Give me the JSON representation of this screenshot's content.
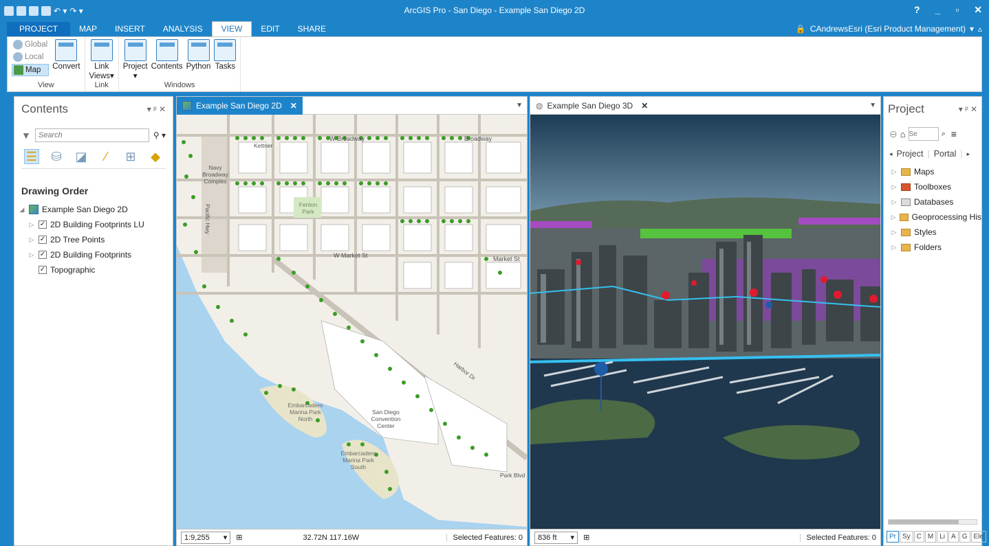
{
  "window": {
    "title": "ArcGIS Pro - San Diego - Example San Diego 2D",
    "help": "?",
    "minimize": "_",
    "restore": "▫",
    "close": "✕"
  },
  "ribbon_tabs": [
    "PROJECT",
    "MAP",
    "INSERT",
    "ANALYSIS",
    "VIEW",
    "EDIT",
    "SHARE"
  ],
  "active_tab": "VIEW",
  "user": {
    "name": "CAndrewsEsri (Esri Product Management)",
    "caret": "▾",
    "collapse": "▵"
  },
  "ribbon": {
    "view_group": {
      "label": "View",
      "global": "Global",
      "local": "Local",
      "map": "Map",
      "convert": "Convert"
    },
    "link_group": {
      "label": "Link",
      "link_views_line1": "Link",
      "link_views_line2": "Views",
      "caret": "▾"
    },
    "windows_group": {
      "label": "Windows",
      "project": "Project",
      "contents": "Contents",
      "python": "Python",
      "tasks": "Tasks"
    }
  },
  "contents": {
    "title": "Contents",
    "pin": "▾ ᵖ ✕",
    "search_placeholder": "Search",
    "section": "Drawing Order",
    "map_name": "Example San Diego 2D",
    "layers": [
      {
        "name": "2D Building Footprints LU",
        "checked": "✓"
      },
      {
        "name": "2D Tree Points",
        "checked": "✓"
      },
      {
        "name": "2D Building Footprints",
        "checked": "✓"
      },
      {
        "name": "Topographic",
        "checked": "✓"
      }
    ]
  },
  "map2d": {
    "tab": "Example San Diego 2D",
    "close": "✕",
    "scale": "1:9,255",
    "coords": "32.72N 117.16W",
    "selected": "Selected Features: 0",
    "labels": {
      "broadway": "W Broadway",
      "broadway_e": "Broadway",
      "market": "W Market St",
      "market_e": "Market St",
      "navy": "Navy Broadway Complex",
      "pacific": "Pacific Hwy",
      "convention": "San Diego Convention Center",
      "marina_north": "Embarcadero Marina Park North",
      "marina_south": "Embarcadero Marina Park South",
      "harbor": "Harbor Dr",
      "parkblvd": "Park Blvd",
      "kettner": "Kettner",
      "park": "Fenton Park"
    }
  },
  "map3d": {
    "tab": "Example San Diego 3D",
    "close": "✕",
    "scale": "836 ft",
    "selected": "Selected Features: 0"
  },
  "project": {
    "title": "Project",
    "pin": "▾ ᵖ ✕",
    "search_placeholder": "Se",
    "tabs": [
      "Project",
      "Portal"
    ],
    "items": [
      "Maps",
      "Toolboxes",
      "Databases",
      "Geoprocessing His",
      "Styles",
      "Folders"
    ],
    "bottom_tabs": [
      "Pr",
      "Sy",
      "C",
      "M",
      "Li",
      "A",
      "G",
      "Ele"
    ]
  },
  "colors": {
    "accent": "#1e84c9",
    "tree": "#3b9d26",
    "water": "#a9d3ef",
    "land": "#f2efe9"
  }
}
